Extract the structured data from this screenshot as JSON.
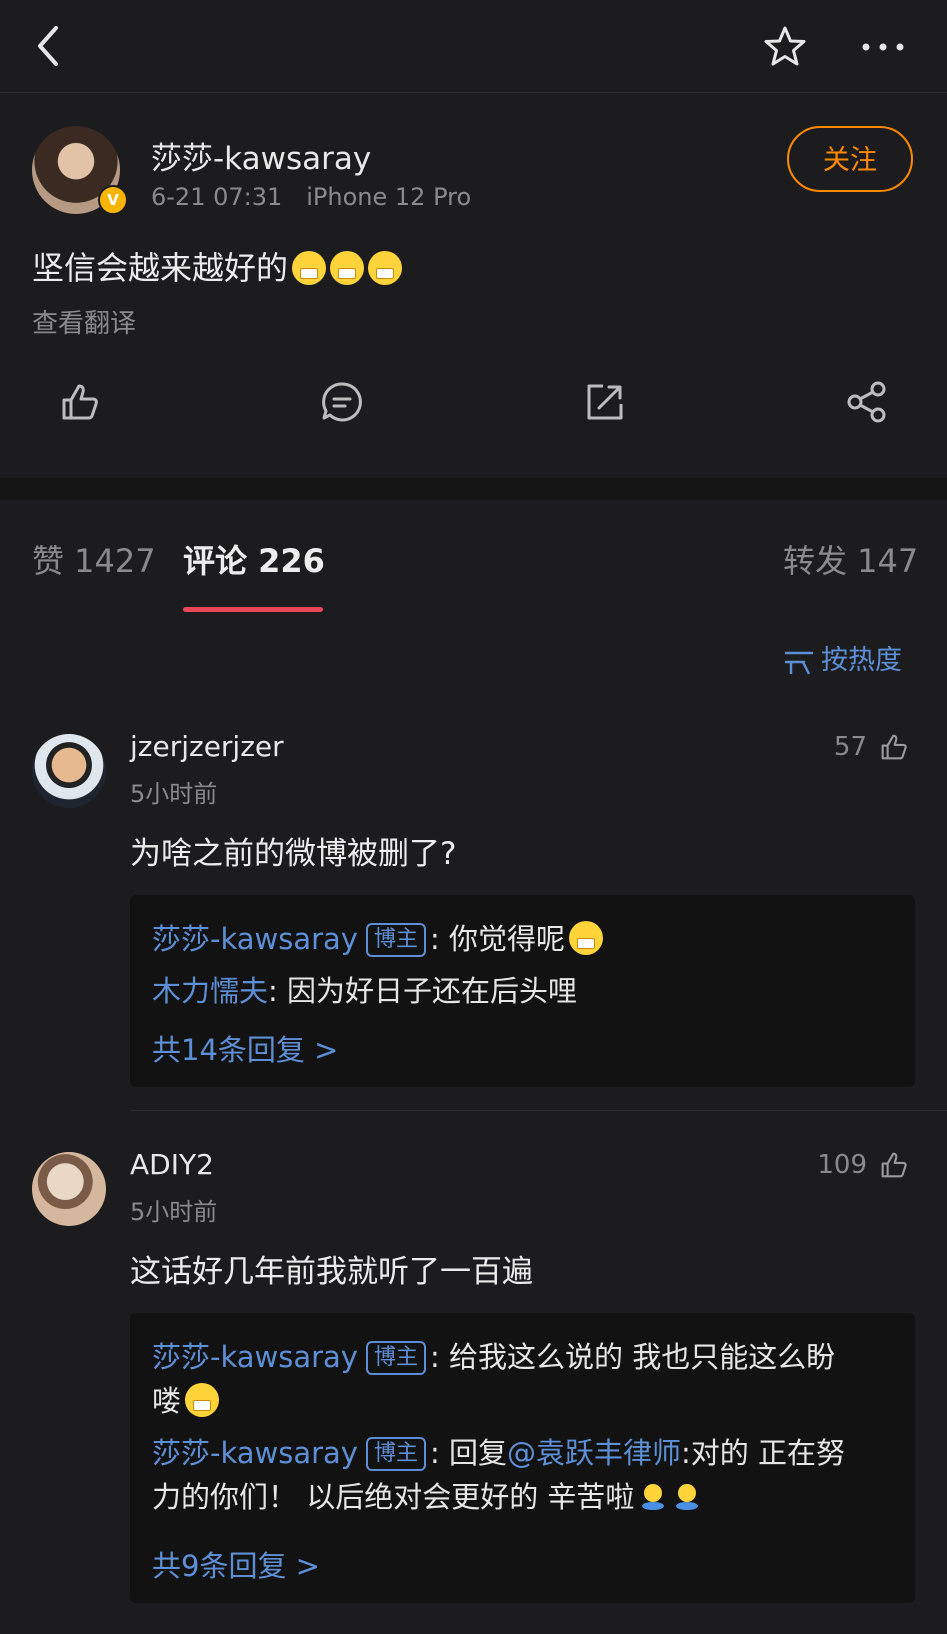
{
  "post": {
    "author": "莎莎-kawsaray",
    "date": "6-21 07:31",
    "device": "iPhone 12 Pro",
    "follow_label": "关注",
    "text": "坚信会越来越好的",
    "emoji_count": 3,
    "translate_label": "查看翻译"
  },
  "tabs": {
    "likes": "赞 1427",
    "comments": "评论 226",
    "reposts": "转发 147"
  },
  "sort_label": "按热度",
  "comments": [
    {
      "user": "jzerjzerjzer",
      "time": "5小时前",
      "likes": "57",
      "text": "为啥之前的微博被删了?",
      "replies": [
        {
          "name": "莎莎-kawsaray",
          "tag": "博主",
          "text": ": 你觉得呢"
        },
        {
          "name": "木力懦夫",
          "text": ": 因为好日子还在后头哩"
        }
      ],
      "more": "共14条回复 >"
    },
    {
      "user": "ADIY2",
      "time": "5小时前",
      "likes": "109",
      "text": "这话好几年前我就听了一百遍",
      "replies": [
        {
          "name": "莎莎-kawsaray",
          "tag": "博主",
          "text": ": 给我这么说的 我也只能这么盼",
          "text2": "喽"
        },
        {
          "name": "莎莎-kawsaray",
          "tag": "博主",
          "text_pre": ": 回复",
          "mention": "@袁跃丰律师",
          "text": ":对的 正在努",
          "text2": "力的你们！ 以后绝对会更好的 辛苦啦"
        }
      ],
      "more": "共9条回复 >"
    }
  ]
}
